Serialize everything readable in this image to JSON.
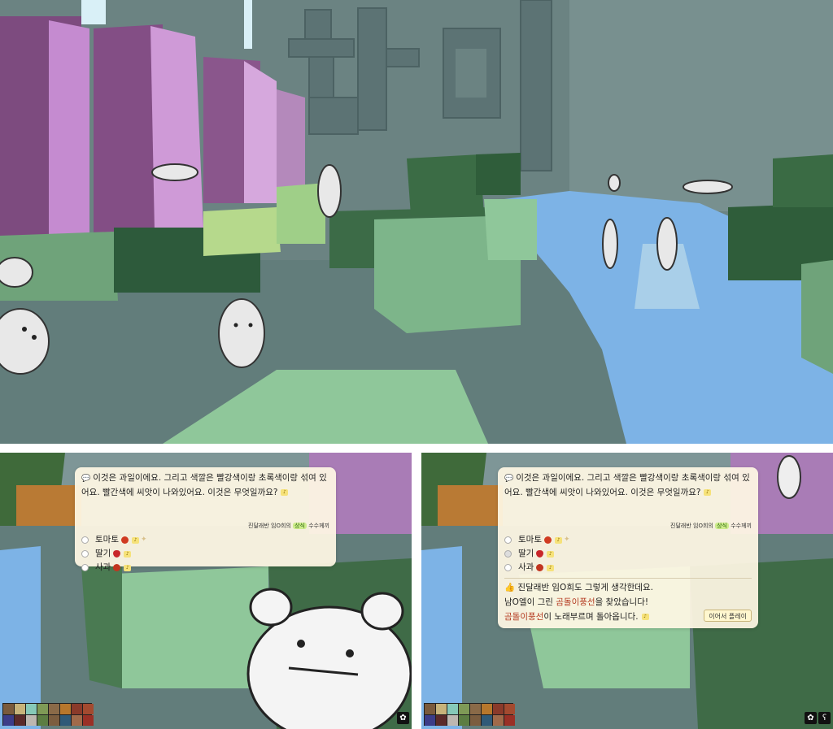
{
  "question": {
    "icon": "speech-bubble-icon",
    "text": "이것은 과일이에요. 그리고 색깔은 빨강색이랑 초록색이랑 섞여 있어요. 빨간색에 씨앗이 나와있어요. 이것은 무엇일까요?"
  },
  "author": {
    "prefix": "진달래반 임O희의",
    "tag": "상식",
    "suffix": "수수께끼"
  },
  "options": [
    {
      "label": "토마토"
    },
    {
      "label": "딸기"
    },
    {
      "label": "사과"
    }
  ],
  "selected_option_index": 1,
  "result": {
    "line1": "진달래반 임O희도 그렇게 생각한데요.",
    "line2_prefix": "남O엘이 그린",
    "line2_highlight": "곰돌이풍선",
    "line2_suffix": "을 찾았습니다!",
    "line3_highlight": "곰돌이풍선",
    "line3_suffix": "이 노래부르며 돌아옵니다.",
    "continue_label": "이어서 플레이"
  },
  "colors": {
    "dialog_bg": "#fff8e4",
    "highlight": "#b43a20",
    "tag_bg": "#cdeb8b",
    "grass": "#8fc79a",
    "water": "#7fb4e8",
    "sky_wall": "#6d8584",
    "purple_block": "#b67fc2"
  },
  "hotbar_colors": [
    "#7a5a3c",
    "#c7b37a",
    "#86c9b8",
    "#7f9a56",
    "#8a6a48",
    "#b7772c",
    "#8a3a2a",
    "#a34a2f",
    "#3c3c88",
    "#5a2a2a",
    "#bdb7b0",
    "#5c7d42",
    "#7b5d3f",
    "#2f5a78",
    "#a06a4a",
    "#9a3026"
  ]
}
